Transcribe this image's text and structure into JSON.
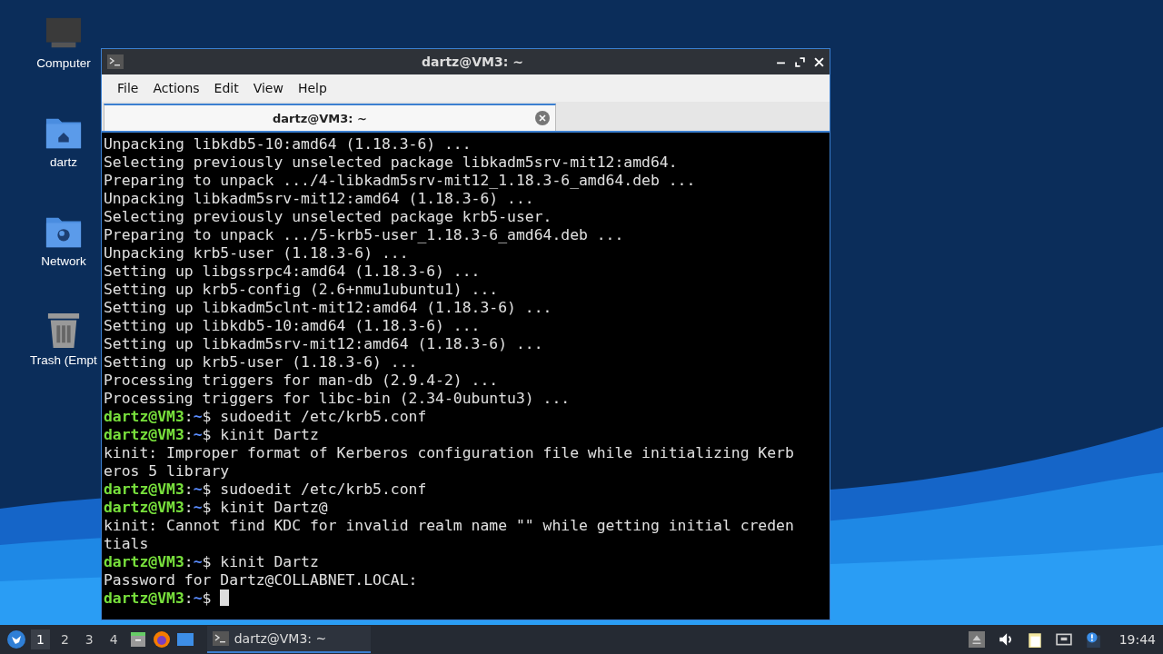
{
  "desktop_icons": [
    {
      "kind": "computer",
      "label": "Computer"
    },
    {
      "kind": "home",
      "label": "dartz"
    },
    {
      "kind": "network",
      "label": "Network"
    },
    {
      "kind": "trash",
      "label": "Trash (Empt"
    }
  ],
  "window": {
    "title": "dartz@VM3: ~",
    "menu": [
      "File",
      "Actions",
      "Edit",
      "View",
      "Help"
    ],
    "tabs": [
      {
        "label": "dartz@VM3: ~",
        "selected": true
      }
    ],
    "terminal_lines": [
      {
        "kind": "output",
        "text": "Unpacking libkdb5-10:amd64 (1.18.3-6) ..."
      },
      {
        "kind": "output",
        "text": "Selecting previously unselected package libkadm5srv-mit12:amd64."
      },
      {
        "kind": "output",
        "text": "Preparing to unpack .../4-libkadm5srv-mit12_1.18.3-6_amd64.deb ..."
      },
      {
        "kind": "output",
        "text": "Unpacking libkadm5srv-mit12:amd64 (1.18.3-6) ..."
      },
      {
        "kind": "output",
        "text": "Selecting previously unselected package krb5-user."
      },
      {
        "kind": "output",
        "text": "Preparing to unpack .../5-krb5-user_1.18.3-6_amd64.deb ..."
      },
      {
        "kind": "output",
        "text": "Unpacking krb5-user (1.18.3-6) ..."
      },
      {
        "kind": "output",
        "text": "Setting up libgssrpc4:amd64 (1.18.3-6) ..."
      },
      {
        "kind": "output",
        "text": "Setting up krb5-config (2.6+nmu1ubuntu1) ..."
      },
      {
        "kind": "output",
        "text": "Setting up libkadm5clnt-mit12:amd64 (1.18.3-6) ..."
      },
      {
        "kind": "output",
        "text": "Setting up libkdb5-10:amd64 (1.18.3-6) ..."
      },
      {
        "kind": "output",
        "text": "Setting up libkadm5srv-mit12:amd64 (1.18.3-6) ..."
      },
      {
        "kind": "output",
        "text": "Setting up krb5-user (1.18.3-6) ..."
      },
      {
        "kind": "output",
        "text": "Processing triggers for man-db (2.9.4-2) ..."
      },
      {
        "kind": "output",
        "text": "Processing triggers for libc-bin (2.34-0ubuntu3) ..."
      },
      {
        "kind": "prompt",
        "user": "dartz@VM3",
        "sep": ":",
        "path": "~",
        "sigil": "$",
        "command": " sudoedit /etc/krb5.conf",
        "cursor": false
      },
      {
        "kind": "prompt",
        "user": "dartz@VM3",
        "sep": ":",
        "path": "~",
        "sigil": "$",
        "command": " kinit Dartz",
        "cursor": false
      },
      {
        "kind": "output",
        "text": "kinit: Improper format of Kerberos configuration file while initializing Kerb"
      },
      {
        "kind": "output",
        "text": "eros 5 library"
      },
      {
        "kind": "prompt",
        "user": "dartz@VM3",
        "sep": ":",
        "path": "~",
        "sigil": "$",
        "command": " sudoedit /etc/krb5.conf",
        "cursor": false
      },
      {
        "kind": "prompt",
        "user": "dartz@VM3",
        "sep": ":",
        "path": "~",
        "sigil": "$",
        "command": " kinit Dartz@",
        "cursor": false
      },
      {
        "kind": "output",
        "text": "kinit: Cannot find KDC for invalid realm name \"\" while getting initial creden"
      },
      {
        "kind": "output",
        "text": "tials"
      },
      {
        "kind": "prompt",
        "user": "dartz@VM3",
        "sep": ":",
        "path": "~",
        "sigil": "$",
        "command": " kinit Dartz",
        "cursor": false
      },
      {
        "kind": "output",
        "text": "Password for Dartz@COLLABNET.LOCAL:"
      },
      {
        "kind": "prompt",
        "user": "dartz@VM3",
        "sep": ":",
        "path": "~",
        "sigil": "$",
        "cursor": true
      }
    ]
  },
  "taskbar": {
    "workspaces": [
      {
        "label": "1",
        "selected": true
      },
      {
        "label": "2",
        "selected": false
      },
      {
        "label": "3",
        "selected": false
      },
      {
        "label": "4",
        "selected": false
      }
    ],
    "tasks": [
      {
        "label": "dartz@VM3: ~",
        "selected": true
      }
    ],
    "clock": "19:44"
  }
}
